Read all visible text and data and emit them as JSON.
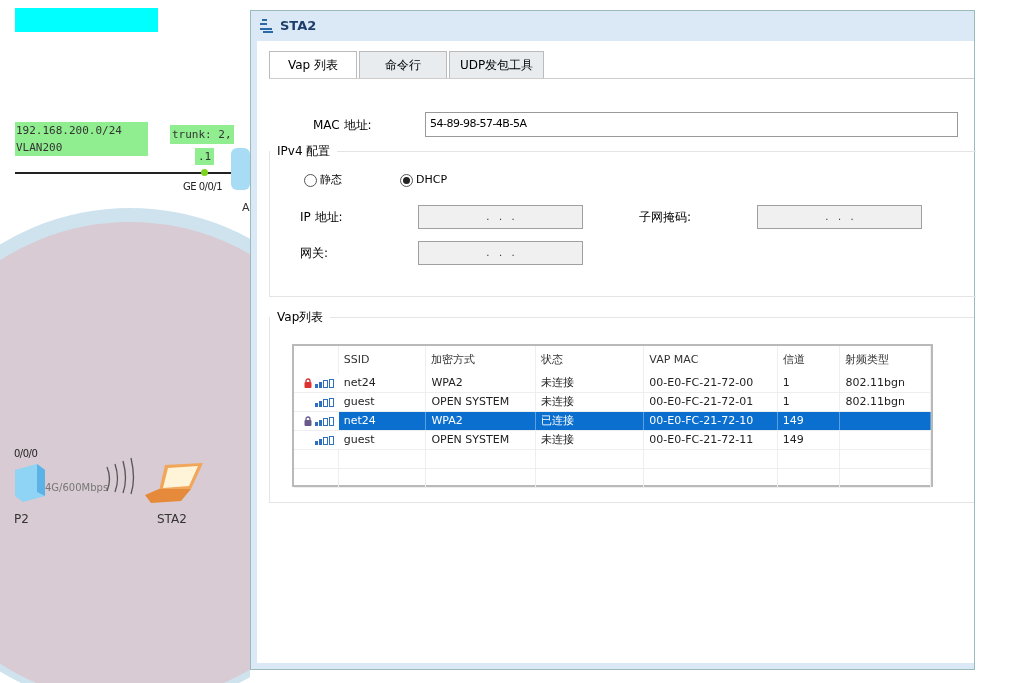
{
  "topology": {
    "subnet_label": [
      "192.168.200.0/24",
      "VLAN200"
    ],
    "trunk_label": "trunk: 2,",
    "ip_label": ".1",
    "port_label": "GE 0/0/1",
    "switch_label": "A",
    "ap_port_label": "0/0/0",
    "link_label": "4G/600Mbps",
    "ap_label": "P2",
    "station_label": "STA2"
  },
  "window": {
    "title": "STA2"
  },
  "tabs": [
    {
      "label": "Vap 列表",
      "selected": true
    },
    {
      "label": "命令行",
      "selected": false
    },
    {
      "label": "UDP发包工具",
      "selected": false
    }
  ],
  "mac": {
    "label": "MAC 地址:",
    "value": "54-89-98-57-4B-5A"
  },
  "ipv4": {
    "title": "IPv4 配置",
    "modes": [
      {
        "label": "静态",
        "selected": false
      },
      {
        "label": "DHCP",
        "selected": true
      }
    ],
    "ip": {
      "label": "IP 地址:",
      "value": ".   .   ."
    },
    "mask": {
      "label": "子网掩码:",
      "value": ".   .   ."
    },
    "gateway": {
      "label": "网关:",
      "value": ".   .   ."
    }
  },
  "vap": {
    "title": "Vap列表",
    "columns": [
      "SSID",
      "加密方式",
      "状态",
      "VAP MAC",
      "信道",
      "射频类型"
    ],
    "rows": [
      {
        "locked": true,
        "selected": false,
        "cells": [
          "net24",
          "WPA2",
          "未连接",
          "00-E0-FC-21-72-00",
          "1",
          "802.11bgn"
        ]
      },
      {
        "locked": false,
        "selected": false,
        "cells": [
          "guest",
          "OPEN SYSTEM",
          "未连接",
          "00-E0-FC-21-72-01",
          "1",
          "802.11bgn"
        ]
      },
      {
        "locked": true,
        "selected": true,
        "cells": [
          "net24",
          "WPA2",
          "已连接",
          "00-E0-FC-21-72-10",
          "149",
          null
        ]
      },
      {
        "locked": false,
        "selected": false,
        "cells": [
          "guest",
          "OPEN SYSTEM",
          "未连接",
          "00-E0-FC-21-72-11",
          "149",
          null
        ]
      }
    ]
  }
}
